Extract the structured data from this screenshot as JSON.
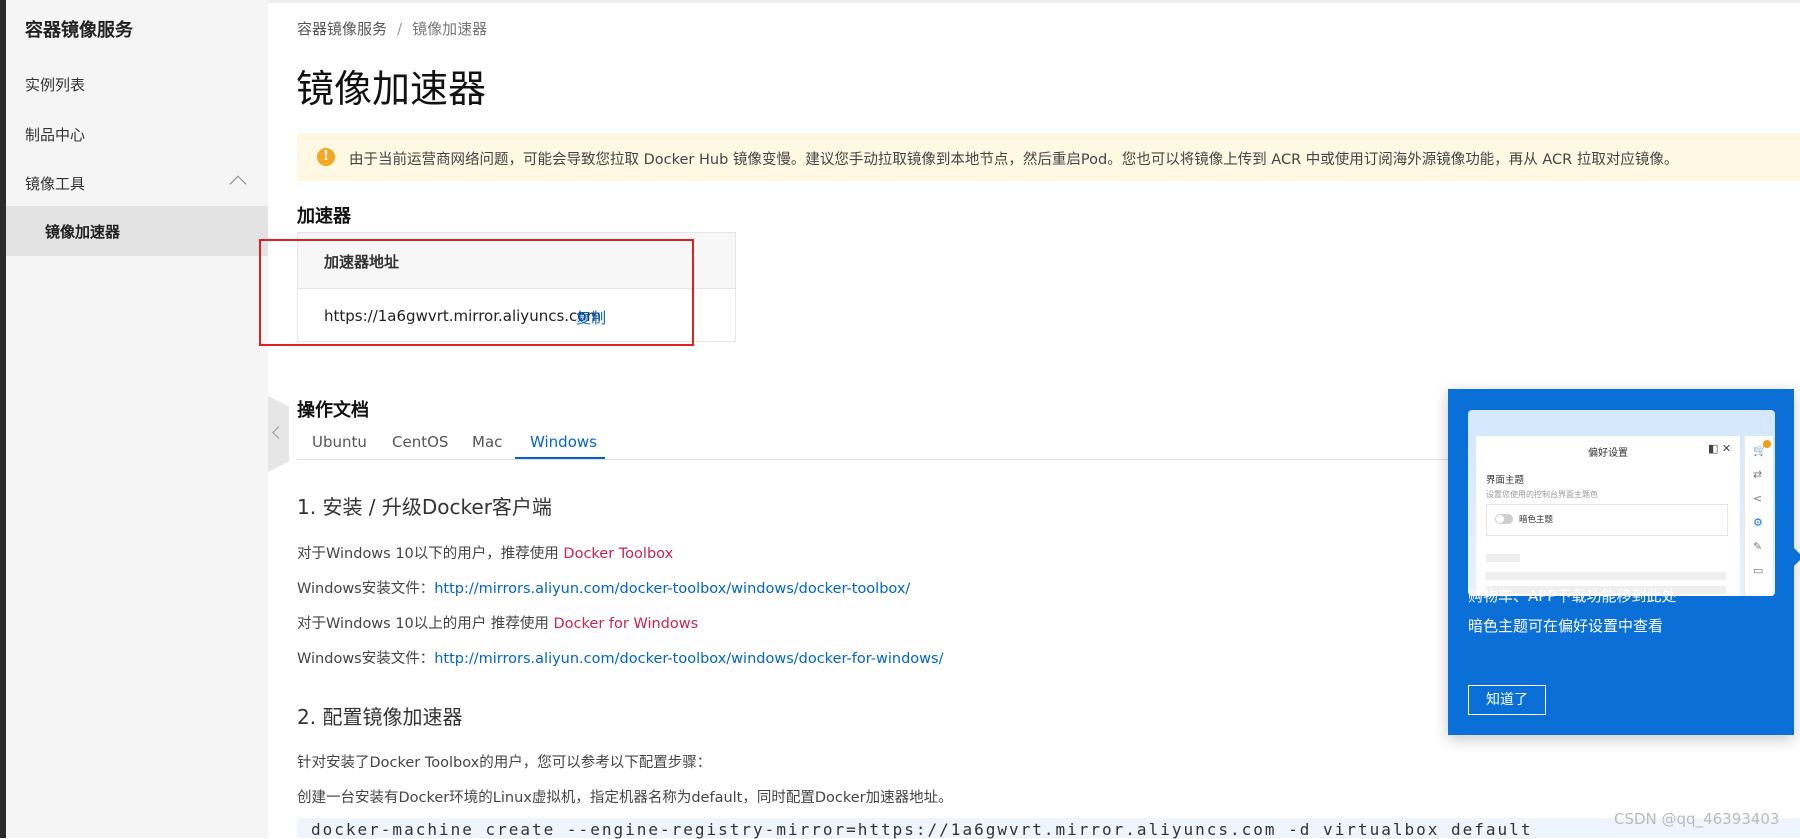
{
  "sidebar": {
    "title": "容器镜像服务",
    "items": [
      {
        "label": "实例列表"
      },
      {
        "label": "制品中心"
      },
      {
        "label": "镜像工具"
      }
    ],
    "sub_item": "镜像加速器"
  },
  "breadcrumb": {
    "root": "容器镜像服务",
    "separator": "/",
    "current": "镜像加速器"
  },
  "page_title": "镜像加速器",
  "notice": {
    "icon": "!",
    "text": "由于当前运营商网络问题，可能会导致您拉取 Docker Hub 镜像变慢。建议您手动拉取镜像到本地节点，然后重启Pod。您也可以将镜像上传到 ACR 中或使用订阅海外源镜像功能，再从 ACR 拉取对应镜像。"
  },
  "accelerator": {
    "section_title": "加速器",
    "column_header": "加速器地址",
    "url": "https://1a6gwvrt.mirror.aliyuncs.com",
    "copy_label": "复制"
  },
  "docs": {
    "section_title": "操作文档",
    "tabs": [
      "Ubuntu",
      "CentOS",
      "Mac",
      "Windows"
    ],
    "active_tab": "Windows",
    "step1_title": "1. 安装 / 升级Docker客户端",
    "line1_prefix": "对于Windows 10以下的用户，推荐使用 ",
    "line1_link": "Docker Toolbox",
    "line2_prefix": "Windows安装文件：",
    "line2_link": "http://mirrors.aliyun.com/docker-toolbox/windows/docker-toolbox/",
    "line3_prefix": "对于Windows 10以上的用户 推荐使用 ",
    "line3_link": "Docker for Windows",
    "line4_prefix": "Windows安装文件：",
    "line4_link": "http://mirrors.aliyun.com/docker-toolbox/windows/docker-for-windows/",
    "step2_title": "2. 配置镜像加速器",
    "step2_line1": "针对安装了Docker Toolbox的用户，您可以参考以下配置步骤：",
    "step2_line2": "创建一台安装有Docker环境的Linux虚拟机，指定机器名称为default，同时配置Docker加速器地址。",
    "code_partial": "docker-machine create --engine-registry-mirror=https://1a6gwvrt.mirror.aliyuncs.com -d virtualbox default"
  },
  "popup": {
    "mock_title": "偏好设置",
    "mock_section": "界面主题",
    "mock_desc": "设置您使用的控制台界面主题色",
    "mock_toggle_label": "暗色主题",
    "line1": "购物车、APP下载功能移到此处",
    "line2": "暗色主题可在偏好设置中查看",
    "button": "知道了"
  },
  "watermark": "CSDN @qq_46393403",
  "colors": {
    "link_blue": "#0064c8",
    "link_red": "#c7254e",
    "popup_bg": "#0a6fd6",
    "notice_bg": "#fff8e3",
    "warning": "#f5a623"
  }
}
